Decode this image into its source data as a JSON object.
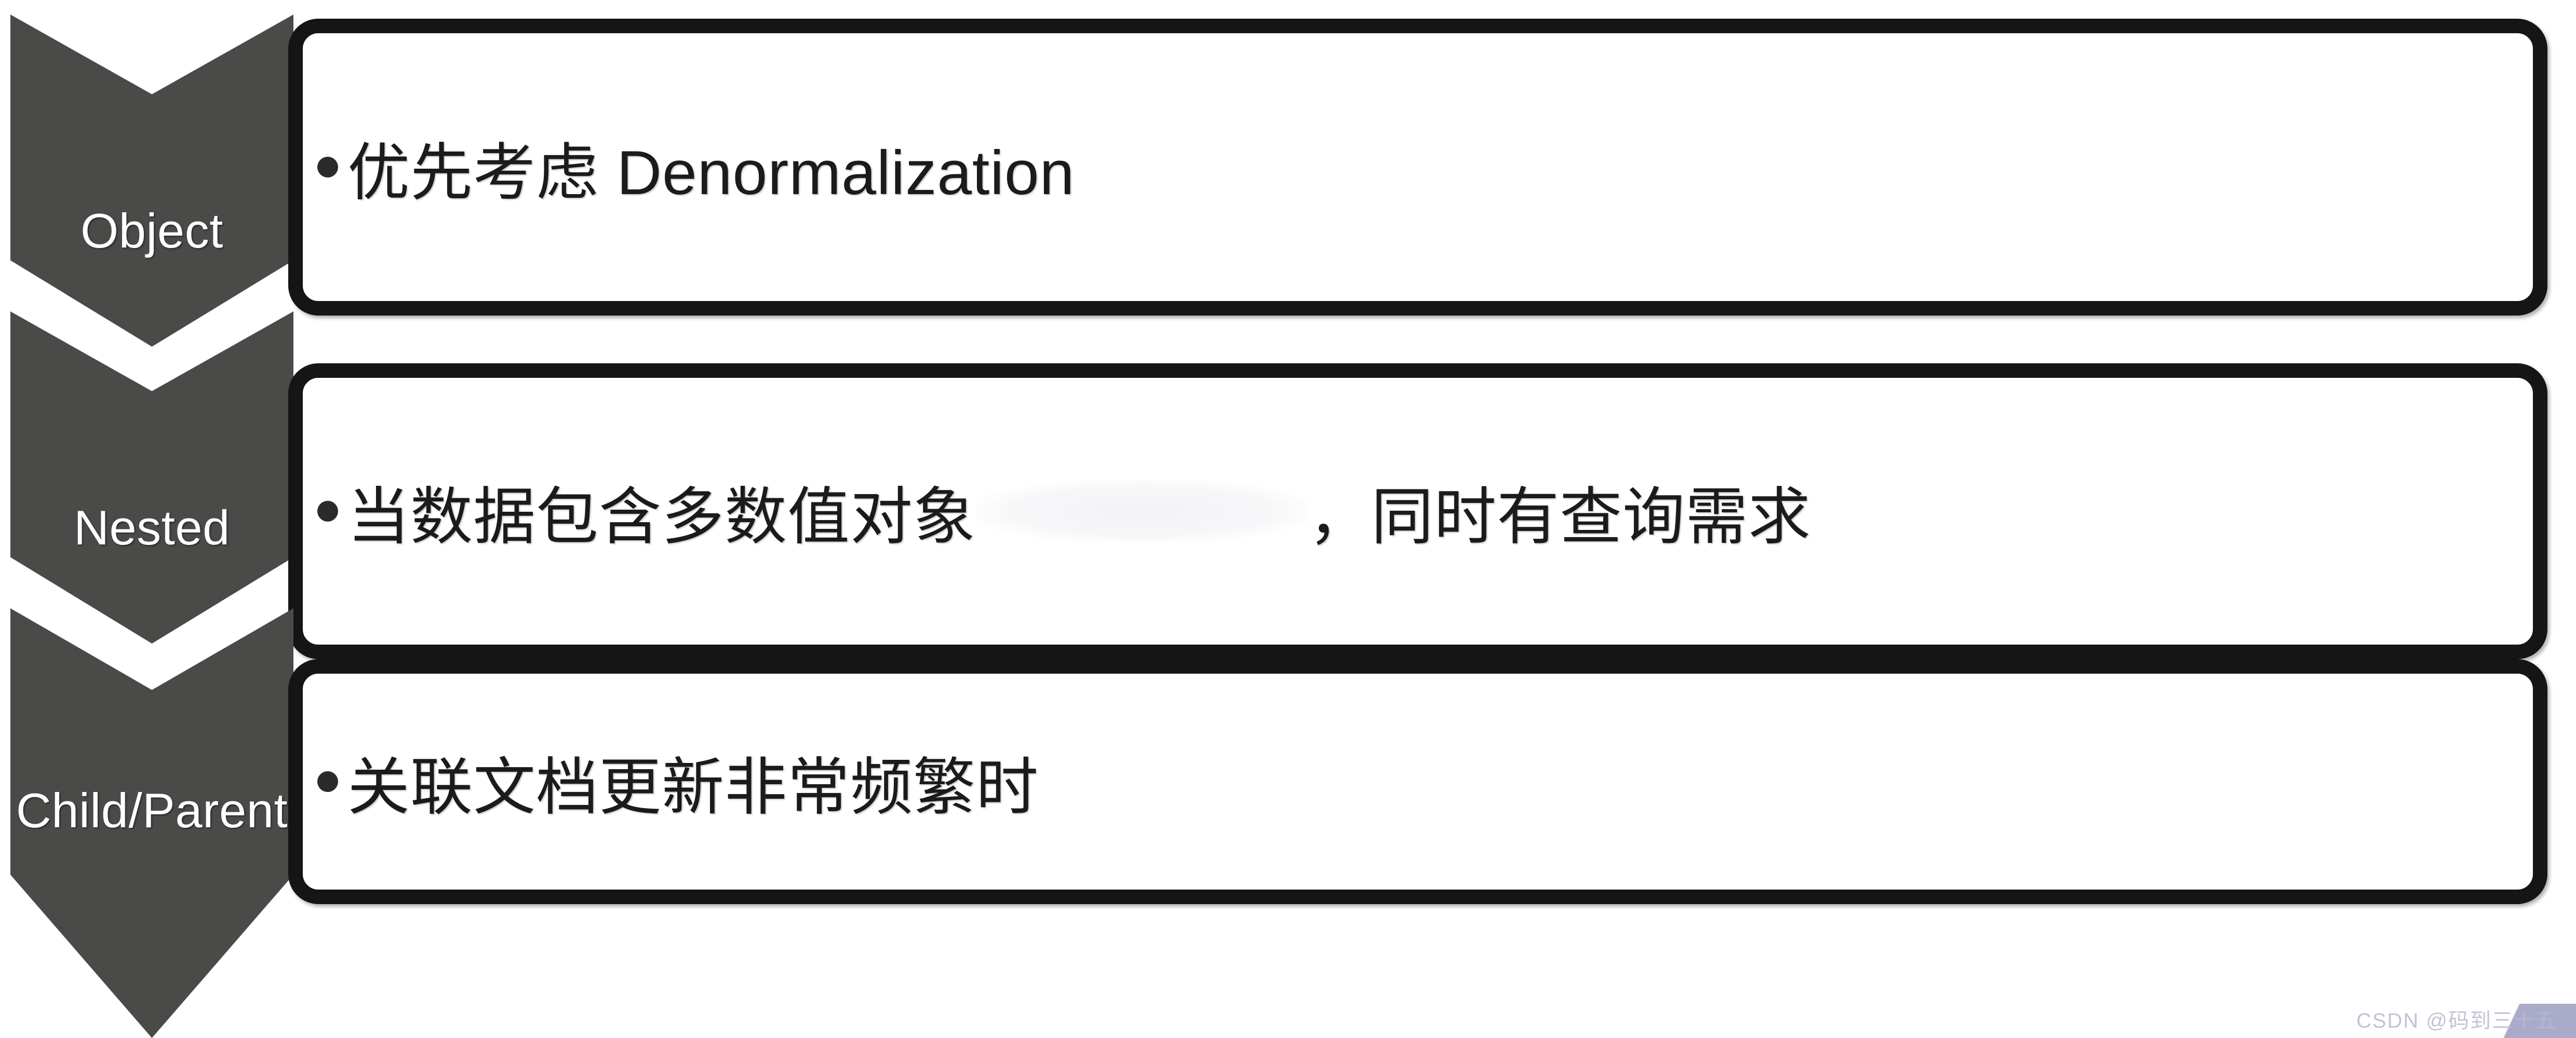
{
  "page": {
    "background_color": "#ffffff",
    "chevron_color": "#4a4a48",
    "box_border_color": "#151515",
    "box_fill_color": "#ffffff",
    "text_color": "#1b1b1b",
    "label_text_color": "#ffffff",
    "watermark_color": "#b7b9d2"
  },
  "rows": [
    {
      "label": "Object",
      "bullet": "•",
      "text": "优先考虑 Denormalization",
      "has_redaction": false
    },
    {
      "label": "Nested",
      "bullet": "•",
      "text_before": "当数据包含多数值对象",
      "text_after": "，同时有查询需求",
      "has_redaction": true
    },
    {
      "label": "Child/Parent",
      "bullet": "•",
      "text": "关联文档更新非常频繁时",
      "has_redaction": false
    }
  ],
  "watermark": {
    "text": "CSDN @码到三十五"
  }
}
